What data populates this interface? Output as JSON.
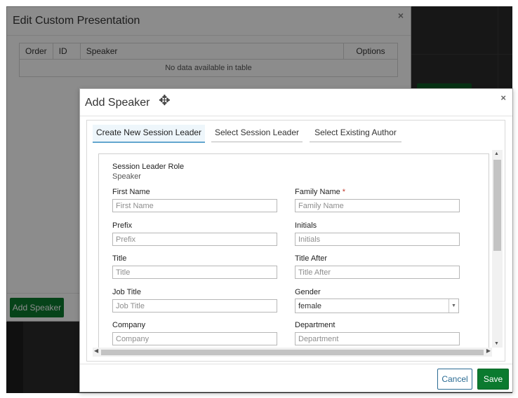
{
  "edit_modal": {
    "title": "Edit Custom Presentation",
    "close_glyph": "×",
    "table": {
      "columns": [
        "Order",
        "ID",
        "Speaker",
        "Options"
      ],
      "empty_text": "No data available in table"
    },
    "add_speaker_button": "Add Speaker"
  },
  "add_speaker_modal": {
    "title": "Add Speaker",
    "close_glyph": "×",
    "move_icon_glyph": "✥",
    "tabs": [
      {
        "label": "Create New Session Leader",
        "active": true
      },
      {
        "label": "Select Session Leader",
        "active": false
      },
      {
        "label": "Select Existing Author",
        "active": false
      }
    ],
    "form": {
      "session_leader_role": {
        "label": "Session Leader Role",
        "value": "Speaker"
      },
      "first_name": {
        "label": "First Name",
        "placeholder": "First Name"
      },
      "family_name": {
        "label": "Family Name",
        "required_mark": "*",
        "placeholder": "Family Name"
      },
      "prefix": {
        "label": "Prefix",
        "placeholder": "Prefix"
      },
      "initials": {
        "label": "Initials",
        "placeholder": "Initials"
      },
      "title": {
        "label": "Title",
        "placeholder": "Title"
      },
      "title_after": {
        "label": "Title After",
        "placeholder": "Title After"
      },
      "job_title": {
        "label": "Job Title",
        "placeholder": "Job Title"
      },
      "gender": {
        "label": "Gender",
        "value": "female"
      },
      "company": {
        "label": "Company",
        "placeholder": "Company"
      },
      "department": {
        "label": "Department",
        "placeholder": "Department"
      }
    },
    "cancel_button": "Cancel",
    "save_button": "Save"
  },
  "colors": {
    "primary_green": "#0b7a2f",
    "tab_active_accent": "#63a6cf",
    "cancel_border": "#2a6b93",
    "required_red": "#c0392b"
  }
}
